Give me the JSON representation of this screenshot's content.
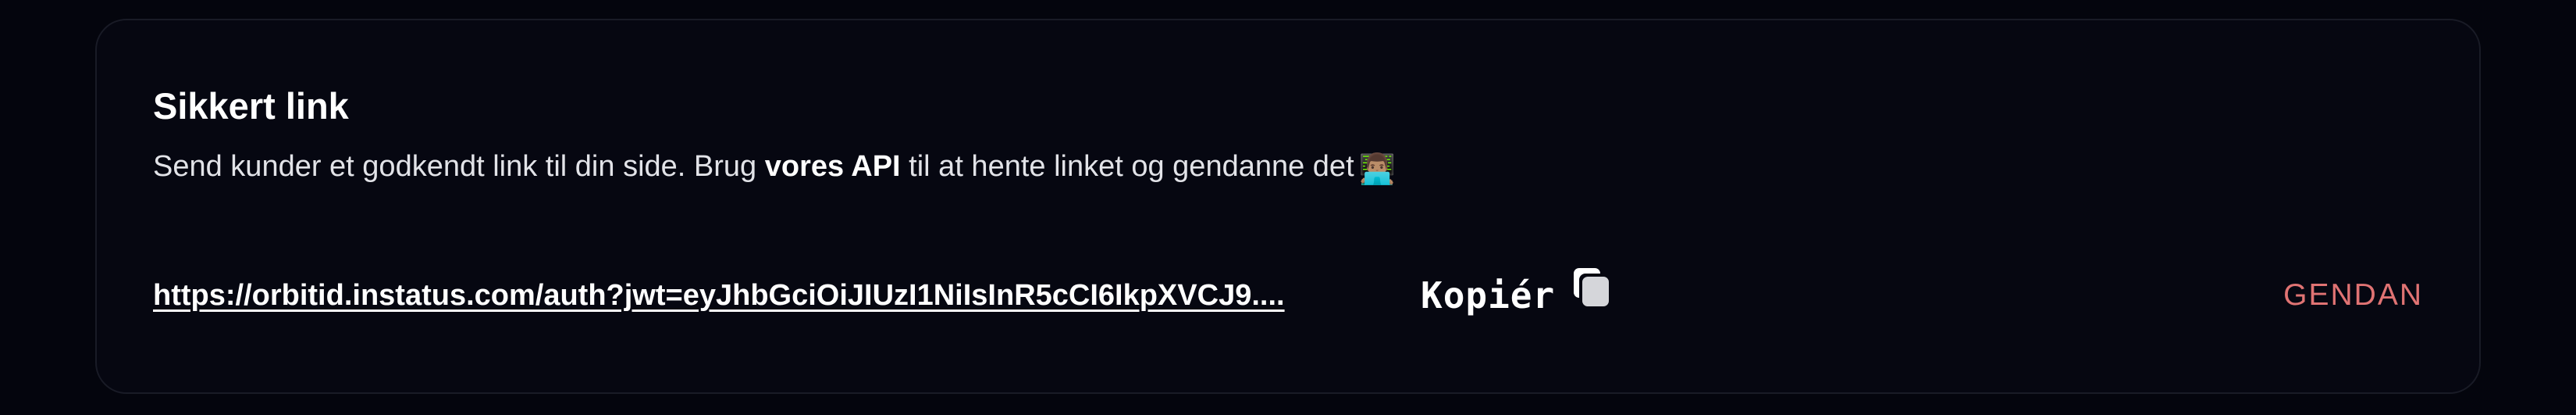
{
  "card": {
    "title": "Sikkert link",
    "description": {
      "before": "Send kunder et godkendt link til din side. Brug ",
      "bold": "vores API",
      "after": " til at hente linket og gendanne det",
      "emoji": "👨🏽‍💻"
    },
    "link": {
      "text": "https://orbitid.instatus.com/auth?jwt=eyJhbGciOiJIUzI1NiIsInR5cCI6IkpXVCJ9...."
    },
    "copy_button": {
      "label": "Kopiér",
      "icon": "copy-icon"
    },
    "restore_button": {
      "label": "GENDAN"
    }
  },
  "colors": {
    "background": "#04050d",
    "card_border": "#191b26",
    "text_primary": "#ffffff",
    "text_secondary": "#e2e3e8",
    "accent_red": "#e07373"
  }
}
